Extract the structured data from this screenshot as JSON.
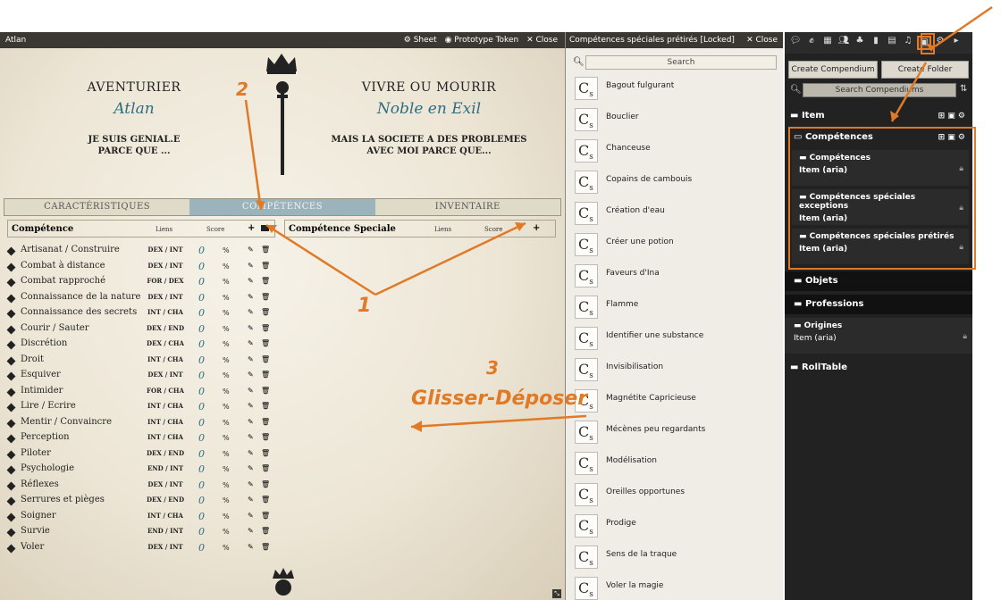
{
  "sheet": {
    "title": "Atlan",
    "actions": [
      "⚙ Sheet",
      "◉ Prototype Token",
      "✕ Close"
    ],
    "left_head": "AVENTURIER",
    "left_name": "Atlan",
    "left_sub": "JE SUIS GENIAL.E\nPARCE QUE ...",
    "right_head": "VIVRE OU MOURIR",
    "right_name": "Noble en Exil",
    "right_sub": "MAIS LA SOCIETE A DES PROBLEMES\nAVEC MOI PARCE QUE...",
    "tabs": [
      "CARACTÉRISTIQUES",
      "COMPÉTENCES",
      "INVENTAIRE"
    ],
    "skills_header": {
      "name": "Compétence",
      "liens": "Liens",
      "score": "Score",
      "add": "+"
    },
    "special_header": {
      "name": "Compétence Speciale",
      "liens": "Liens",
      "score": "Score",
      "add": "+"
    },
    "skills": [
      {
        "name": "Artisanat / Construire",
        "liens": "DEX / INT",
        "val": "0"
      },
      {
        "name": "Combat à distance",
        "liens": "DEX / INT",
        "val": "0"
      },
      {
        "name": "Combat rapproché",
        "liens": "FOR / DEX",
        "val": "0"
      },
      {
        "name": "Connaissance de la nature",
        "liens": "DEX / INT",
        "val": "0"
      },
      {
        "name": "Connaissance des secrets",
        "liens": "INT / CHA",
        "val": "0"
      },
      {
        "name": "Courir / Sauter",
        "liens": "DEX / END",
        "val": "0"
      },
      {
        "name": "Discrétion",
        "liens": "DEX / CHA",
        "val": "0"
      },
      {
        "name": "Droit",
        "liens": "INT / CHA",
        "val": "0"
      },
      {
        "name": "Esquiver",
        "liens": "DEX / INT",
        "val": "0"
      },
      {
        "name": "Intimider",
        "liens": "FOR / CHA",
        "val": "0"
      },
      {
        "name": "Lire / Ecrire",
        "liens": "INT / CHA",
        "val": "0"
      },
      {
        "name": "Mentir / Convaincre",
        "liens": "INT / CHA",
        "val": "0"
      },
      {
        "name": "Perception",
        "liens": "INT / CHA",
        "val": "0"
      },
      {
        "name": "Piloter",
        "liens": "DEX / END",
        "val": "0"
      },
      {
        "name": "Psychologie",
        "liens": "END / INT",
        "val": "0"
      },
      {
        "name": "Réflexes",
        "liens": "DEX / INT",
        "val": "0"
      },
      {
        "name": "Serrures et pièges",
        "liens": "DEX / END",
        "val": "0"
      },
      {
        "name": "Soigner",
        "liens": "INT / CHA",
        "val": "0"
      },
      {
        "name": "Survie",
        "liens": "END / INT",
        "val": "0"
      },
      {
        "name": "Voler",
        "liens": "DEX / INT",
        "val": "0"
      }
    ],
    "pct": "%"
  },
  "compendium": {
    "title": "Compétences spéciales prétirés [Locked]",
    "close": "✕ Close",
    "search_placeholder": "Search",
    "entries": [
      "Bagout fulgurant",
      "Bouclier",
      "Chanceuse",
      "Copains de cambouis",
      "Création d'eau",
      "Créer une potion",
      "Faveurs d'Ina",
      "Flamme",
      "Identifier une substance",
      "Invisibilisation",
      "Magnétite Capricieuse",
      "Mécènes peu regardants",
      "Modélisation",
      "Oreilles opportunes",
      "Prodige",
      "Sens de la traque",
      "Voler la magie"
    ]
  },
  "sidebar": {
    "create_compendium": "Create Compendium",
    "create_folder": "Create Folder",
    "search_placeholder": "Search Compendiums",
    "folders": {
      "item": "Item",
      "competences": "Compétences",
      "objets": "Objets",
      "professions": "Professions",
      "rolltable": "RollTable"
    },
    "packs": [
      {
        "name": "Compétences",
        "type": "Item (aria)"
      },
      {
        "name": "Compétences spéciales exceptions",
        "type": "Item (aria)"
      },
      {
        "name": "Compétences spéciales prétirés",
        "type": "Item (aria)"
      }
    ],
    "origines": {
      "name": "Origines",
      "type": "Item (aria)"
    }
  },
  "annotations": {
    "one": "1",
    "two": "2",
    "three": "3",
    "drag": "Glisser-Déposer"
  },
  "colors": {
    "accent": "#e07a26",
    "name_blue": "#2f6e80"
  }
}
